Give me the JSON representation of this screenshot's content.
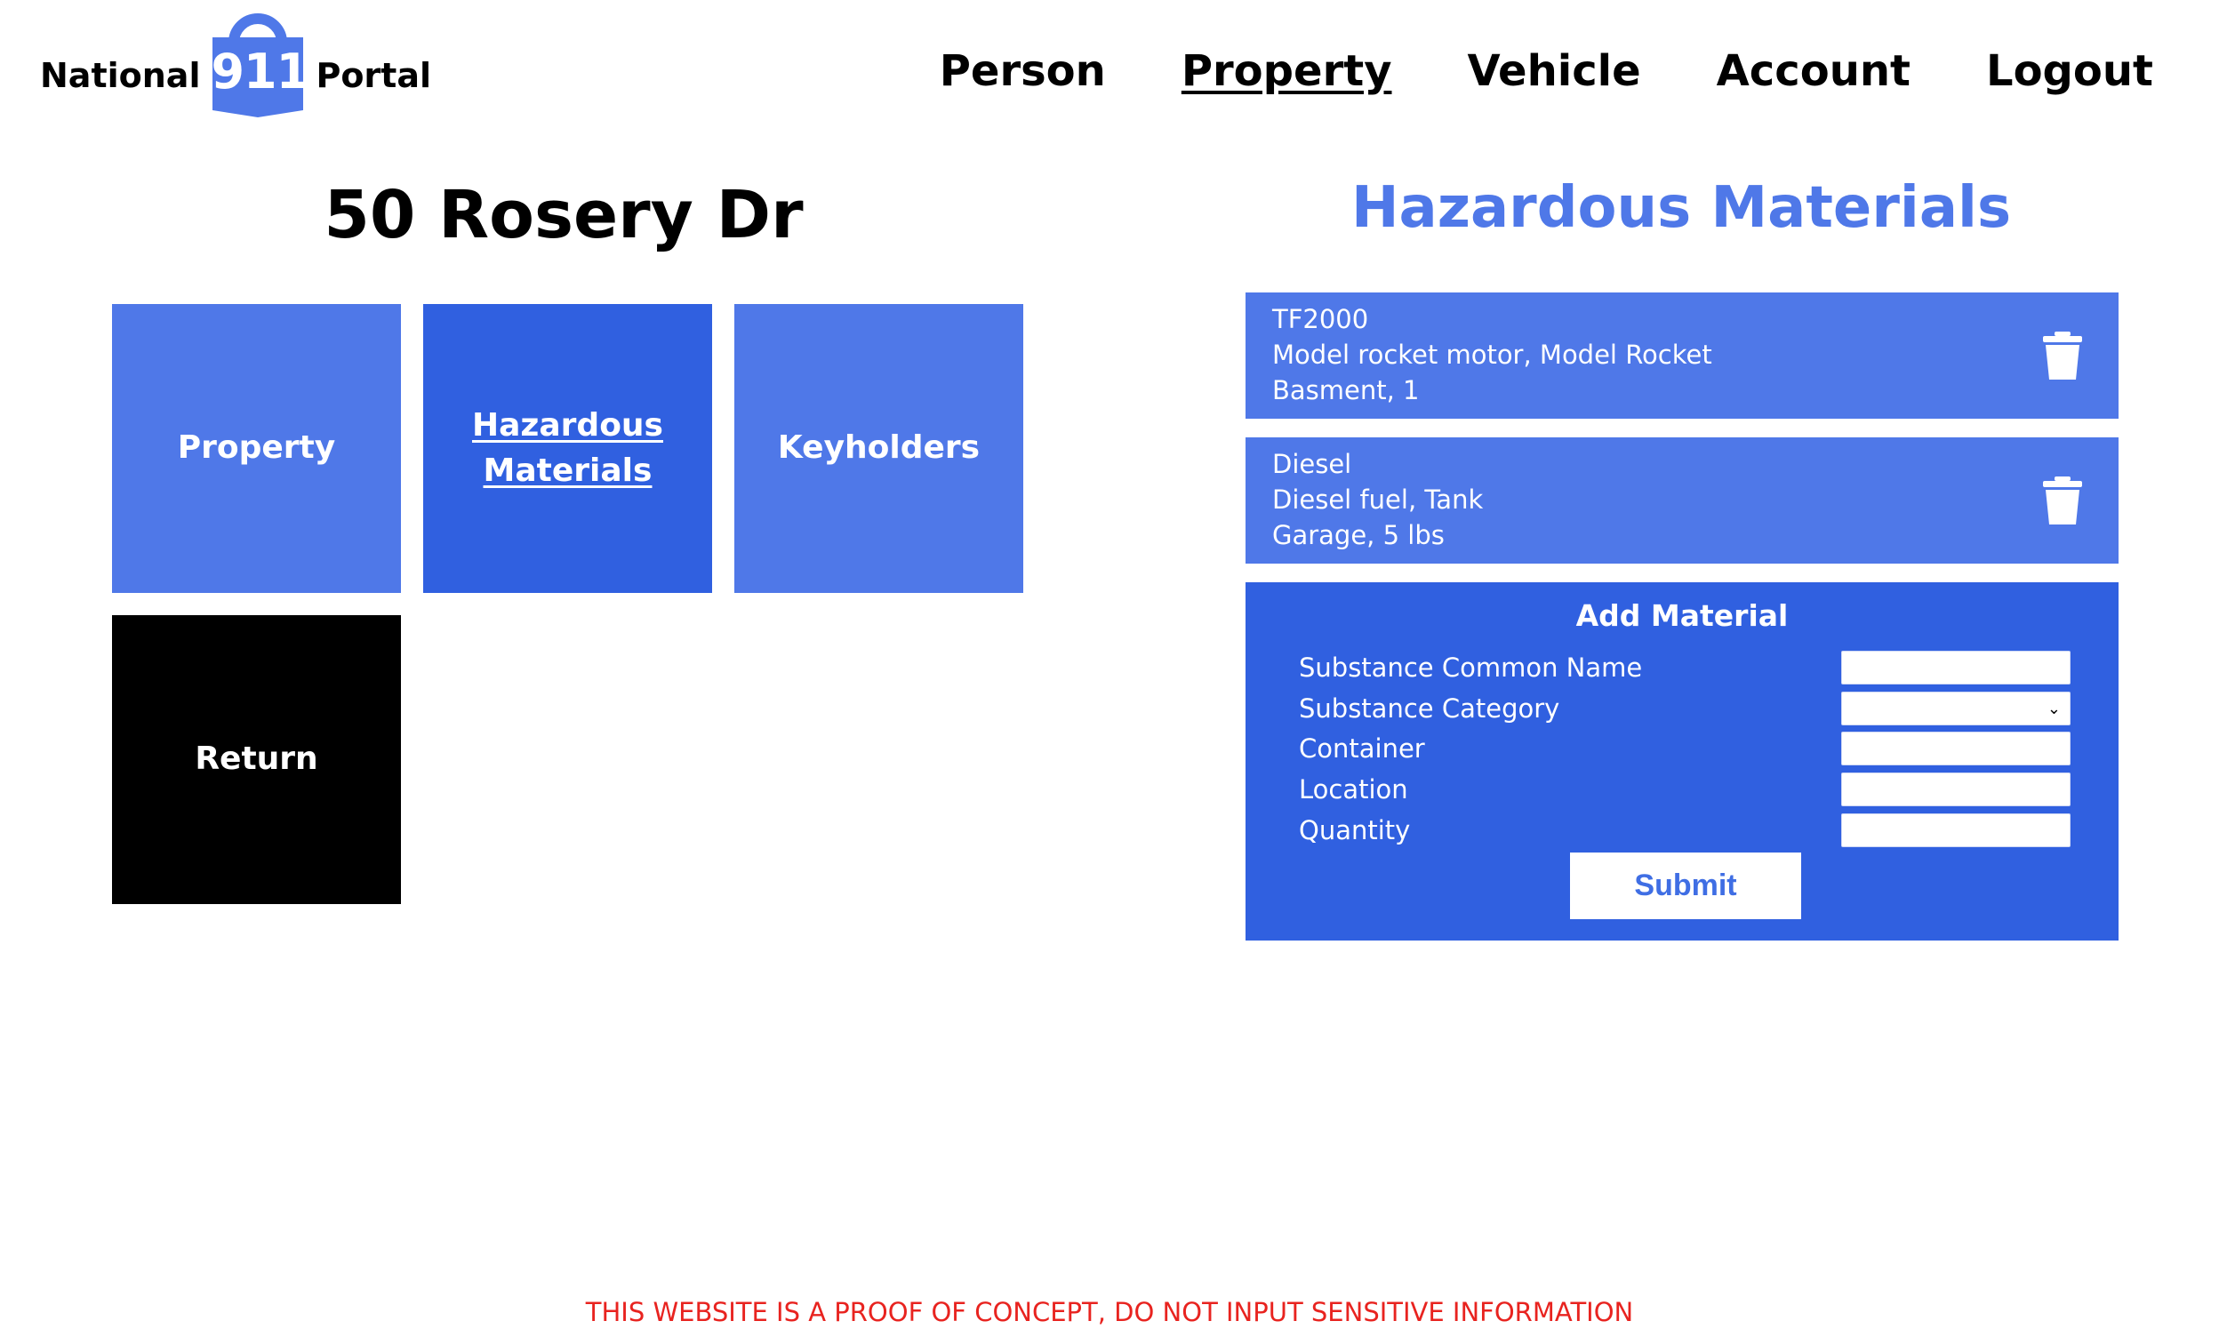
{
  "logo": {
    "left_word": "National",
    "number": "911",
    "right_word": "Portal",
    "icon": "padlock-badge-icon",
    "color": "#4f78e8"
  },
  "nav": {
    "items": [
      {
        "label": "Person",
        "active": false
      },
      {
        "label": "Property",
        "active": true
      },
      {
        "label": "Vehicle",
        "active": false
      },
      {
        "label": "Account",
        "active": false
      },
      {
        "label": "Logout",
        "active": false
      }
    ]
  },
  "property": {
    "address": "50 Rosery Dr"
  },
  "tiles": {
    "property": "Property",
    "hazmat_line1": "Hazardous",
    "hazmat_line2": "Materials",
    "keyholders": "Keyholders",
    "return": "Return"
  },
  "hazmat": {
    "title": "Hazardous Materials",
    "materials": [
      {
        "name": "TF2000",
        "description": "Model rocket motor, Model Rocket",
        "location_quantity": "Basment, 1",
        "delete_icon": "trash-icon"
      },
      {
        "name": "Diesel",
        "description": "Diesel fuel, Tank",
        "location_quantity": "Garage, 5 lbs",
        "delete_icon": "trash-icon"
      }
    ]
  },
  "add_form": {
    "title": "Add Material",
    "fields": {
      "common_name": {
        "label": "Substance Common Name",
        "value": ""
      },
      "category": {
        "label": "Substance Category",
        "value": ""
      },
      "container": {
        "label": "Container",
        "value": ""
      },
      "location": {
        "label": "Location",
        "value": ""
      },
      "quantity": {
        "label": "Quantity",
        "value": ""
      }
    },
    "submit_label": "Submit"
  },
  "footer": {
    "disclaimer": "THIS WEBSITE IS A PROOF OF CONCEPT, DO NOT INPUT SENSITIVE INFORMATION"
  },
  "colors": {
    "primary_light": "#4f78e8",
    "primary_dark": "#3060e0",
    "return_tile": "#000000",
    "disclaimer": "#e8231f"
  }
}
